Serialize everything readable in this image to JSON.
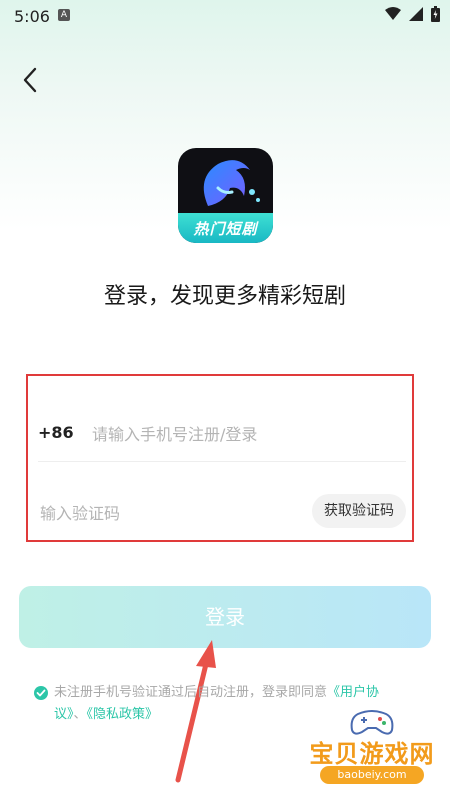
{
  "status_bar": {
    "time": "5:06",
    "notification_letter": "A"
  },
  "app": {
    "logo_text": "热门短剧"
  },
  "headline": "登录，发现更多精彩短剧",
  "phone": {
    "country_code": "+86",
    "placeholder": "请输入手机号注册/登录",
    "value": ""
  },
  "code": {
    "placeholder": "输入验证码",
    "value": "",
    "get_code_label": "获取验证码"
  },
  "login_label": "登录",
  "agreement": {
    "text": "未注册手机号验证通过后自动注册，登录即同意",
    "link_user": "《用户协议》",
    "separator": "、",
    "link_privacy": "《隐私政策》"
  },
  "watermark": {
    "title": "宝贝游戏网",
    "url": "baobeiy.com"
  },
  "colors": {
    "accent": "#2cc6a8",
    "highlight": "#e03a3a",
    "watermark": "#f29b1b"
  }
}
